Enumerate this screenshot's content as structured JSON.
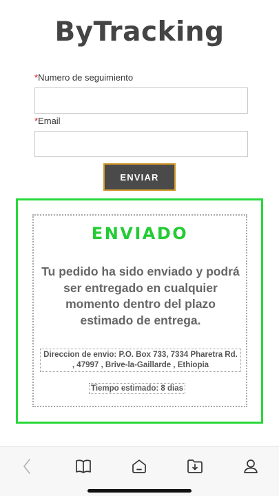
{
  "header": {
    "title": "ByTracking"
  },
  "form": {
    "tracking_label": "Numero de seguimiento",
    "tracking_value": "",
    "email_label": "Email",
    "email_value": "",
    "required_mark": "*",
    "submit_label": "ENVIAR"
  },
  "result": {
    "status": "ENVIADO",
    "message": "Tu pedido ha sido enviado y podrá ser entregado en cualquier momento dentro del plazo estimado de entrega.",
    "address": "Direccion de envio: P.O. Box 733, 7334 Pharetra Rd. , 47997 , Brive-la-Gaillarde , Ethiopia",
    "estimated_time": "Tiempo estimado: 8 dias",
    "accent_color": "#22cc33"
  },
  "bottom_nav": {
    "icons": [
      "back-icon",
      "book-icon",
      "home-icon",
      "download-folder-icon",
      "profile-icon"
    ]
  }
}
